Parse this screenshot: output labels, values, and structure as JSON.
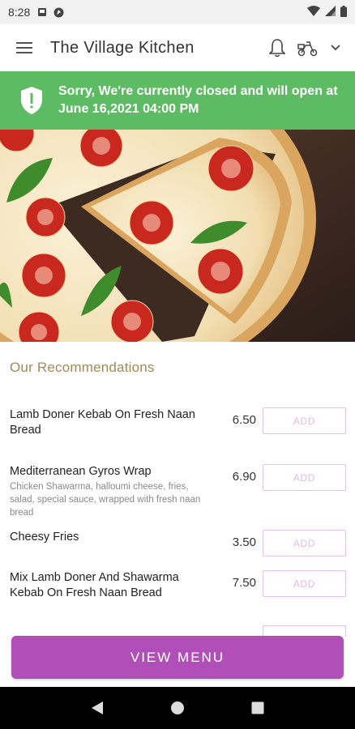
{
  "status_bar": {
    "time": "8:28",
    "icons": [
      "notification-icon",
      "app-icon",
      "wifi-icon",
      "signal-icon",
      "battery-icon"
    ]
  },
  "app_bar": {
    "title": "The Village Kitchen",
    "icons": [
      "hamburger-menu-icon",
      "bell-icon",
      "delivery-icon",
      "chevron-down-icon"
    ]
  },
  "banner": {
    "message": "Sorry, We're currently closed and will open at June 16,2021 04:00 PM",
    "color": "#5dbb63"
  },
  "recommendations": {
    "title": "Our Recommendations",
    "items": [
      {
        "name": "Lamb Doner Kebab On Fresh Naan Bread",
        "description": "",
        "price": "6.50",
        "add_label": "ADD"
      },
      {
        "name": "Mediterranean Gyros Wrap",
        "description": "Chicken Shawarma, halloumi cheese, fries, salad, special sauce, wrapped with fresh naan bread",
        "price": "6.90",
        "add_label": "ADD"
      },
      {
        "name": "Cheesy Fries",
        "description": "",
        "price": "3.50",
        "add_label": "ADD"
      },
      {
        "name": "Mix Lamb Doner And Shawarma Kebab On Fresh Naan Bread",
        "description": "",
        "price": "7.50",
        "add_label": "ADD"
      }
    ]
  },
  "cta": {
    "label": "VIEW MENU",
    "color": "#b14fb8"
  },
  "nav": {
    "icons": [
      "back-icon",
      "home-icon",
      "recents-icon"
    ]
  }
}
